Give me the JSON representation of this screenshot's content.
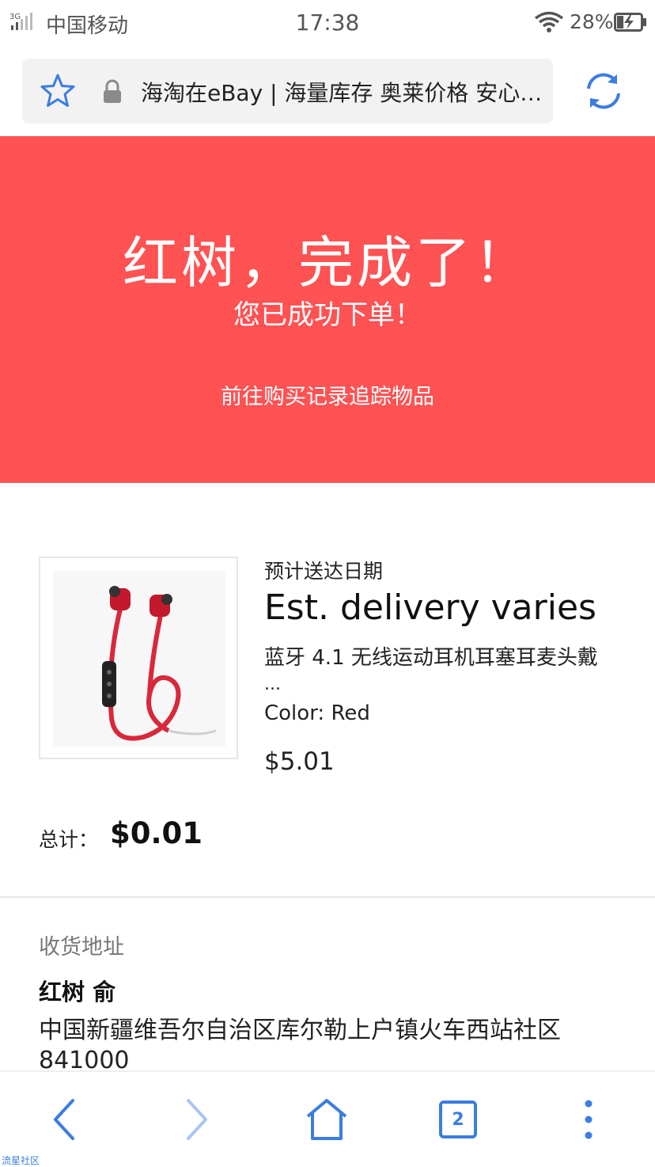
{
  "status_bar": {
    "network": "3G",
    "carrier": "中国移动",
    "time": "17:38",
    "battery_percent": "28%",
    "battery_level": 0.28
  },
  "address_bar": {
    "page_title": "海淘在eBay | 海量库存 奥莱价格 安心…"
  },
  "hero": {
    "title": "红树，完成了！",
    "subtitle": "您已成功下单！",
    "link": "前往购买记录追踪物品",
    "background_color": "#ff5253"
  },
  "order_item": {
    "delivery_label": "预计送达日期",
    "delivery_value": "Est. delivery varies",
    "title": "蓝牙 4.1 无线运动耳机耳塞耳麦头戴",
    "title_ellipsis": "...",
    "color": "Color: Red",
    "price": "$5.01",
    "image_icon": "red-wireless-earphones"
  },
  "total": {
    "label": "总计：",
    "value": "$0.01"
  },
  "shipping": {
    "heading": "收货地址",
    "name": "红树 俞",
    "address_line1": "中国新疆维吾尔自治区库尔勒上户镇火车西站社区",
    "address_line2": "841000"
  },
  "bottom_nav": {
    "tab_count": "2",
    "accent_color": "#3b7de0"
  },
  "watermark": "流星社区"
}
